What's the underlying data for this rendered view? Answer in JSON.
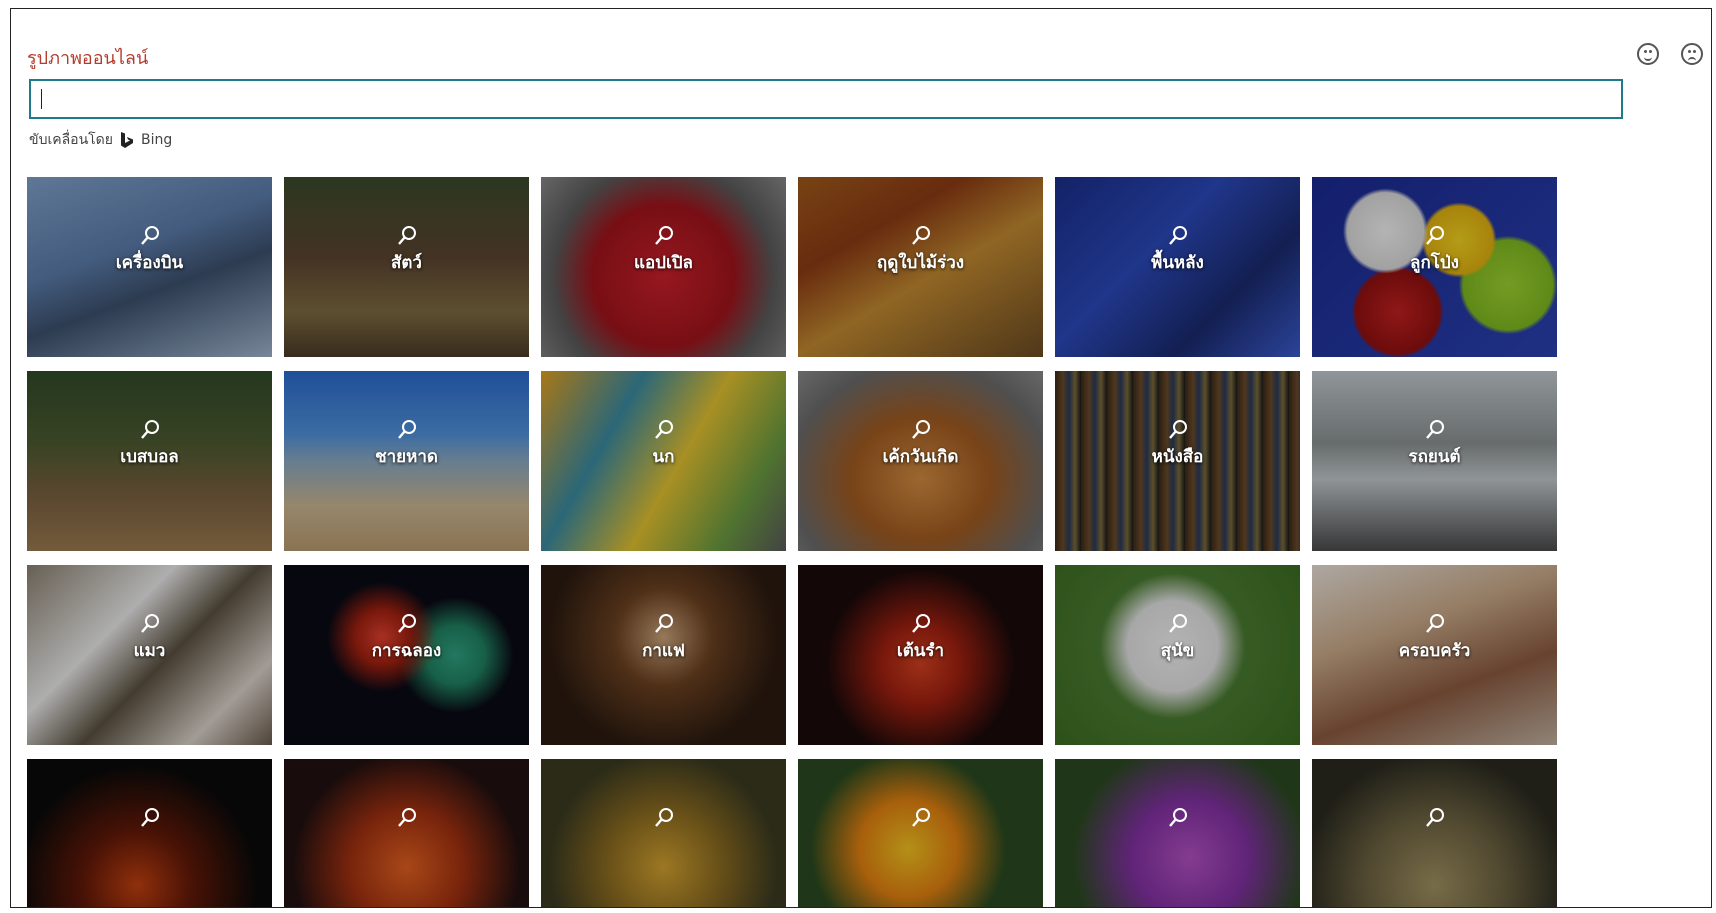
{
  "dialog": {
    "title": "รูปภาพออนไลน์",
    "search": {
      "value": "",
      "placeholder": ""
    },
    "powered_by": "ขับเคลื่อนโดย",
    "bing_label": "Bing",
    "icons": {
      "smile": "smile-icon",
      "frown": "frown-icon",
      "search": "magnifier-icon"
    }
  },
  "categories": [
    "เครื่องบิน",
    "สัตว์",
    "แอปเปิล",
    "ฤดูใบไม้ร่วง",
    "พื้นหลัง",
    "ลูกโป่ง",
    "เบสบอล",
    "ชายหาด",
    "นก",
    "เค้กวันเกิด",
    "หนังสือ",
    "รถยนต์",
    "แมว",
    "การฉลอง",
    "กาแฟ",
    "เต้นรำ",
    "สุนัข",
    "ครอบครัว",
    "",
    "",
    "",
    "",
    "",
    ""
  ],
  "colors": {
    "search_border": "#1f7a8c",
    "title": "#b43c2c"
  }
}
